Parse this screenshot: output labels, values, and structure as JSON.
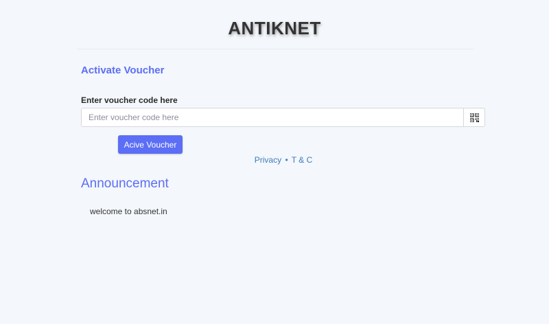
{
  "header": {
    "brand": "ANTIKNET"
  },
  "voucher": {
    "section_title": "Activate Voucher",
    "field_label": "Enter voucher code here",
    "input_placeholder": "Enter voucher code here",
    "input_value": "",
    "qr_icon": "qr-code-icon",
    "button_label": "Acive Voucher"
  },
  "footer": {
    "privacy_label": "Privacy",
    "separator": "•",
    "terms_label": "T & C"
  },
  "announcement": {
    "title": "Announcement",
    "text": "welcome to absnet.in"
  },
  "colors": {
    "accent": "#5b6ef5",
    "link": "#3d7bbf",
    "background": "#f4f7fb"
  }
}
